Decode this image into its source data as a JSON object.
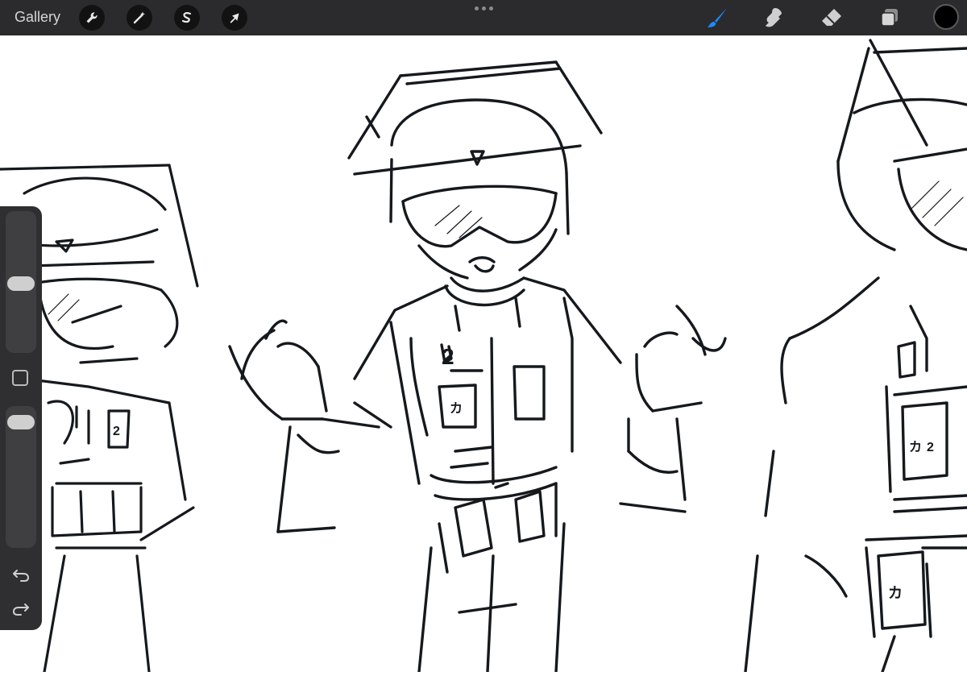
{
  "toolbar": {
    "gallery_label": "Gallery",
    "left_tools": [
      {
        "icon": "wrench-icon"
      },
      {
        "icon": "magic-wand-icon"
      },
      {
        "icon": "selection-icon"
      },
      {
        "icon": "transform-arrow-icon"
      }
    ],
    "right_tools": [
      {
        "icon": "brush-icon",
        "active": true,
        "color": "#1a8cff"
      },
      {
        "icon": "smudge-icon"
      },
      {
        "icon": "eraser-icon"
      },
      {
        "icon": "layers-icon"
      }
    ],
    "current_color": "#000000"
  },
  "sidebar": {
    "brush_size_level": 0.49,
    "opacity_level": 0.93
  },
  "canvas": {
    "description_icon": "sketch-drawing",
    "lettering": [
      "2",
      "カ",
      "カ",
      "カ",
      "2",
      "2"
    ]
  }
}
